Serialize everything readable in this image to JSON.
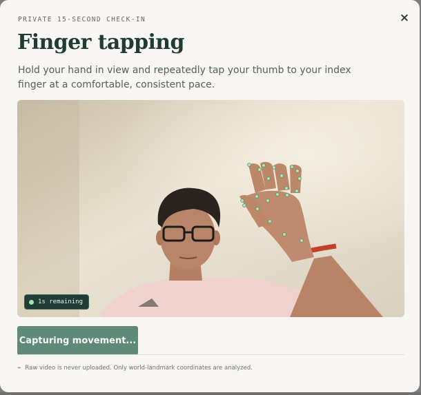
{
  "dialog": {
    "eyebrow": "PRIVATE 15-SECOND CHECK-IN",
    "close_label": "×",
    "title": "Finger tapping",
    "description": "Hold your hand in view and repeatedly tap your thumb to your index finger at a comfortable, consistent pace.",
    "timer_text": "1s remaining",
    "capture_button_label": "Capturing movement...",
    "privacy_note": "Raw video is never uploaded. Only world-landmark coordinates are analyzed."
  },
  "icons": {
    "close": "close-icon",
    "recording": "recording-dot-icon",
    "privacy": "shield-off-icon"
  },
  "colors": {
    "accent": "#5f8a79",
    "title": "#1f3b33",
    "landmark": "#a8e8b8",
    "privacy_icon": "#c0624f"
  }
}
